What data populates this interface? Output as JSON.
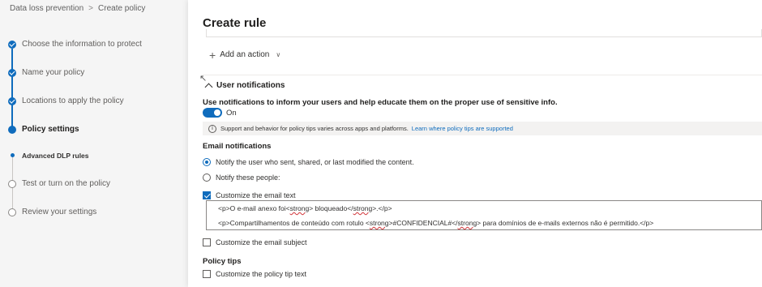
{
  "breadcrumb": {
    "items": [
      "Data loss prevention",
      "Create policy"
    ]
  },
  "steps": [
    {
      "label": "Choose the information to protect",
      "state": "done"
    },
    {
      "label": "Name your policy",
      "state": "done"
    },
    {
      "label": "Locations to apply the policy",
      "state": "done"
    },
    {
      "label": "Policy settings",
      "state": "current"
    },
    {
      "label": "Advanced DLP rules",
      "state": "sub"
    },
    {
      "label": "Test or turn on the policy",
      "state": "todo"
    },
    {
      "label": "Review your settings",
      "state": "todo"
    }
  ],
  "panel": {
    "title": "Create rule",
    "add_action": "Add an action",
    "user_notifications": {
      "header": "User notifications",
      "description": "Use notifications to inform your users and help educate them on the proper use of sensitive info.",
      "toggle": {
        "label": "On",
        "on": true
      },
      "info": {
        "text": "Support and behavior for policy tips varies across apps and platforms.",
        "link": "Learn where policy tips are supported"
      }
    },
    "email_notifications": {
      "title": "Email notifications",
      "notify_sender": "Notify the user who sent, shared, or last modified the content.",
      "notify_people": "Notify these people:",
      "customize_text": "Customize the email text",
      "email_text": {
        "line1_a": "<p>O e-mail anexo foi<",
        "line1_b": "strong",
        "line1_c": "> bloqueado</",
        "line1_d": "strong",
        "line1_e": ">.</p>",
        "line2_a": "<p>Compartilhamentos de conteúdo com rotulo <",
        "line2_b": "strong",
        "line2_c": ">#CONFIDENCIAL#</",
        "line2_d": "strong",
        "line2_e": "> para domínios de e-mails externos não é permitido.</p>"
      },
      "customize_subject": "Customize the email subject"
    },
    "policy_tips": {
      "title": "Policy tips",
      "customize_tip": "Customize the policy tip text"
    }
  },
  "colors": {
    "accent": "#0f6cbd",
    "panel_bg": "#ffffff",
    "nav_bg": "#f5f5f5"
  }
}
